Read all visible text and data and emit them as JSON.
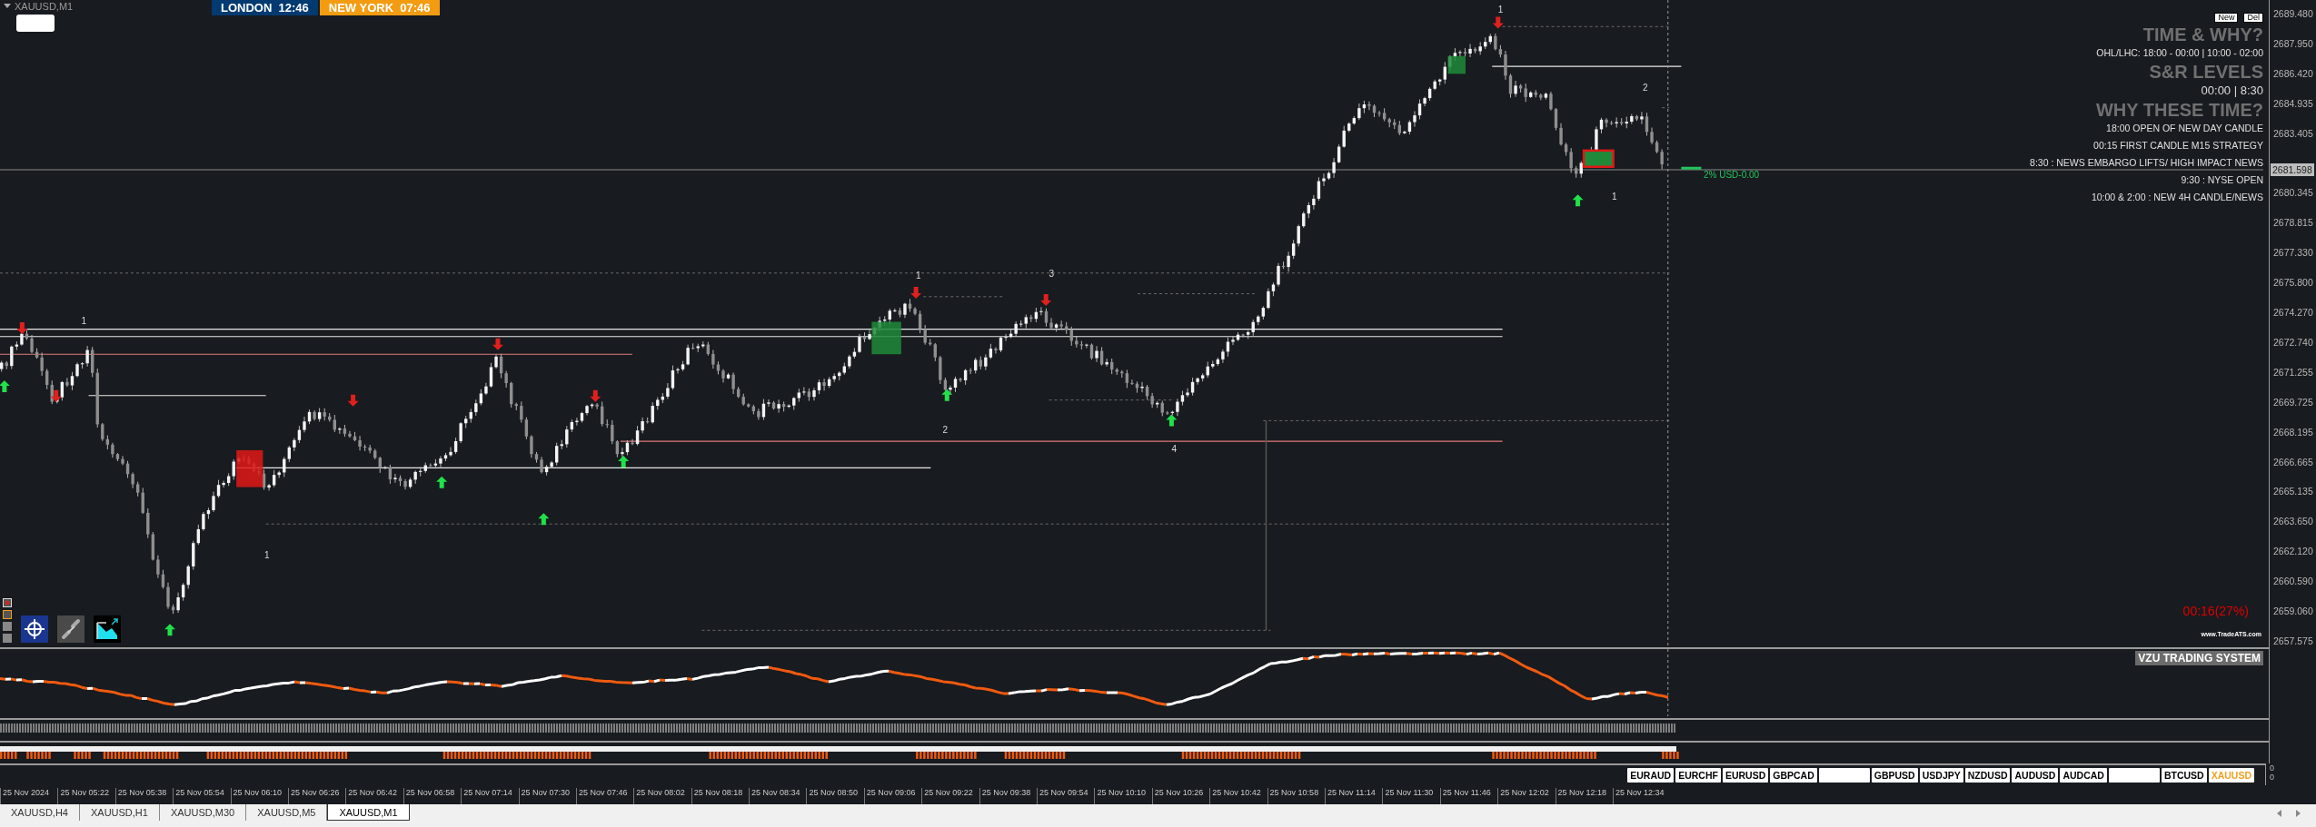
{
  "chart": {
    "symbol_label": "XAUUSD,M1",
    "sessions": [
      {
        "city": "LONDON",
        "time": "12:46",
        "color": "#003a70"
      },
      {
        "city": "NEW YORK",
        "time": "07:46",
        "color": "#f39c12"
      }
    ],
    "panel_buttons": [
      "New",
      "Del"
    ],
    "info_lines": [
      {
        "kind": "heading",
        "text": "TIME & WHY?"
      },
      {
        "kind": "note",
        "text": "OHL/LHC: 18:00 - 00:00 | 10:00 - 02:00"
      },
      {
        "kind": "heading",
        "text": "S&R LEVELS"
      },
      {
        "kind": "subheading",
        "text": "00:00 | 8:30"
      },
      {
        "kind": "heading",
        "text": "WHY THESE TIME?"
      },
      {
        "kind": "note",
        "text": "18:00 OPEN OF NEW DAY CANDLE"
      },
      {
        "kind": "note",
        "text": "00:15 FIRST CANDLE M15 STRATEGY"
      },
      {
        "kind": "note",
        "text": "8:30 : NEWS EMBARGO LIFTS/ HIGH IMPACT NEWS"
      },
      {
        "kind": "note",
        "text": "9:30 : NYSE OPEN"
      },
      {
        "kind": "note",
        "text": "10:00 & 2:00 : NEW 4H CANDLE/NEWS"
      }
    ],
    "wave_labels": [
      "1",
      "2",
      "1",
      "1",
      "3",
      "2",
      "4",
      "1",
      "1"
    ],
    "spread_label": "2% USD-0.00",
    "countdown": "00:16(27%)",
    "site_link": "www.TradeATS.com"
  },
  "price_axis": {
    "ticks": [
      "2689.480",
      "2687.950",
      "2686.420",
      "2684.935",
      "2683.405",
      "2680.345",
      "2678.815",
      "2677.330",
      "2675.800",
      "2674.270",
      "2672.740",
      "2671.255",
      "2669.725",
      "2668.195",
      "2666.665",
      "2665.135",
      "2663.650",
      "2662.120",
      "2660.590",
      "2659.060",
      "2657.575"
    ],
    "current_price": "2681.598",
    "panel_scale": [
      "0",
      "0"
    ]
  },
  "indicator": {
    "title": "VZU TRADING SYSTEM"
  },
  "symbols": [
    {
      "label": "EURAUD",
      "selected": false
    },
    {
      "label": "EURCHF",
      "selected": false
    },
    {
      "label": "EURUSD",
      "selected": false
    },
    {
      "label": "GBPCAD",
      "selected": false
    },
    {
      "kind": "blank"
    },
    {
      "label": "GBPUSD",
      "selected": false
    },
    {
      "label": "USDJPY",
      "selected": false
    },
    {
      "label": "NZDUSD",
      "selected": false
    },
    {
      "label": "AUDUSD",
      "selected": false
    },
    {
      "label": "AUDCAD",
      "selected": false
    },
    {
      "kind": "blank"
    },
    {
      "label": "BTCUSD",
      "selected": false
    },
    {
      "label": "XAUUSD",
      "selected": true
    }
  ],
  "time_axis": [
    "25 Nov 2024",
    "25 Nov 05:22",
    "25 Nov 05:38",
    "25 Nov 05:54",
    "25 Nov 06:10",
    "25 Nov 06:26",
    "25 Nov 06:42",
    "25 Nov 06:58",
    "25 Nov 07:14",
    "25 Nov 07:30",
    "25 Nov 07:46",
    "25 Nov 08:02",
    "25 Nov 08:18",
    "25 Nov 08:34",
    "25 Nov 08:50",
    "25 Nov 09:06",
    "25 Nov 09:22",
    "25 Nov 09:38",
    "25 Nov 09:54",
    "25 Nov 10:10",
    "25 Nov 10:26",
    "25 Nov 10:42",
    "25 Nov 10:58",
    "25 Nov 11:14",
    "25 Nov 11:30",
    "25 Nov 11:46",
    "25 Nov 12:02",
    "25 Nov 12:18",
    "25 Nov 12:34"
  ],
  "tabs": [
    {
      "label": "XAUUSD,H4",
      "selected": false
    },
    {
      "label": "XAUUSD,H1",
      "selected": false
    },
    {
      "label": "XAUUSD,M30",
      "selected": false
    },
    {
      "label": "XAUUSD,M5",
      "selected": false
    },
    {
      "label": "XAUUSD,M1",
      "selected": true
    }
  ]
}
